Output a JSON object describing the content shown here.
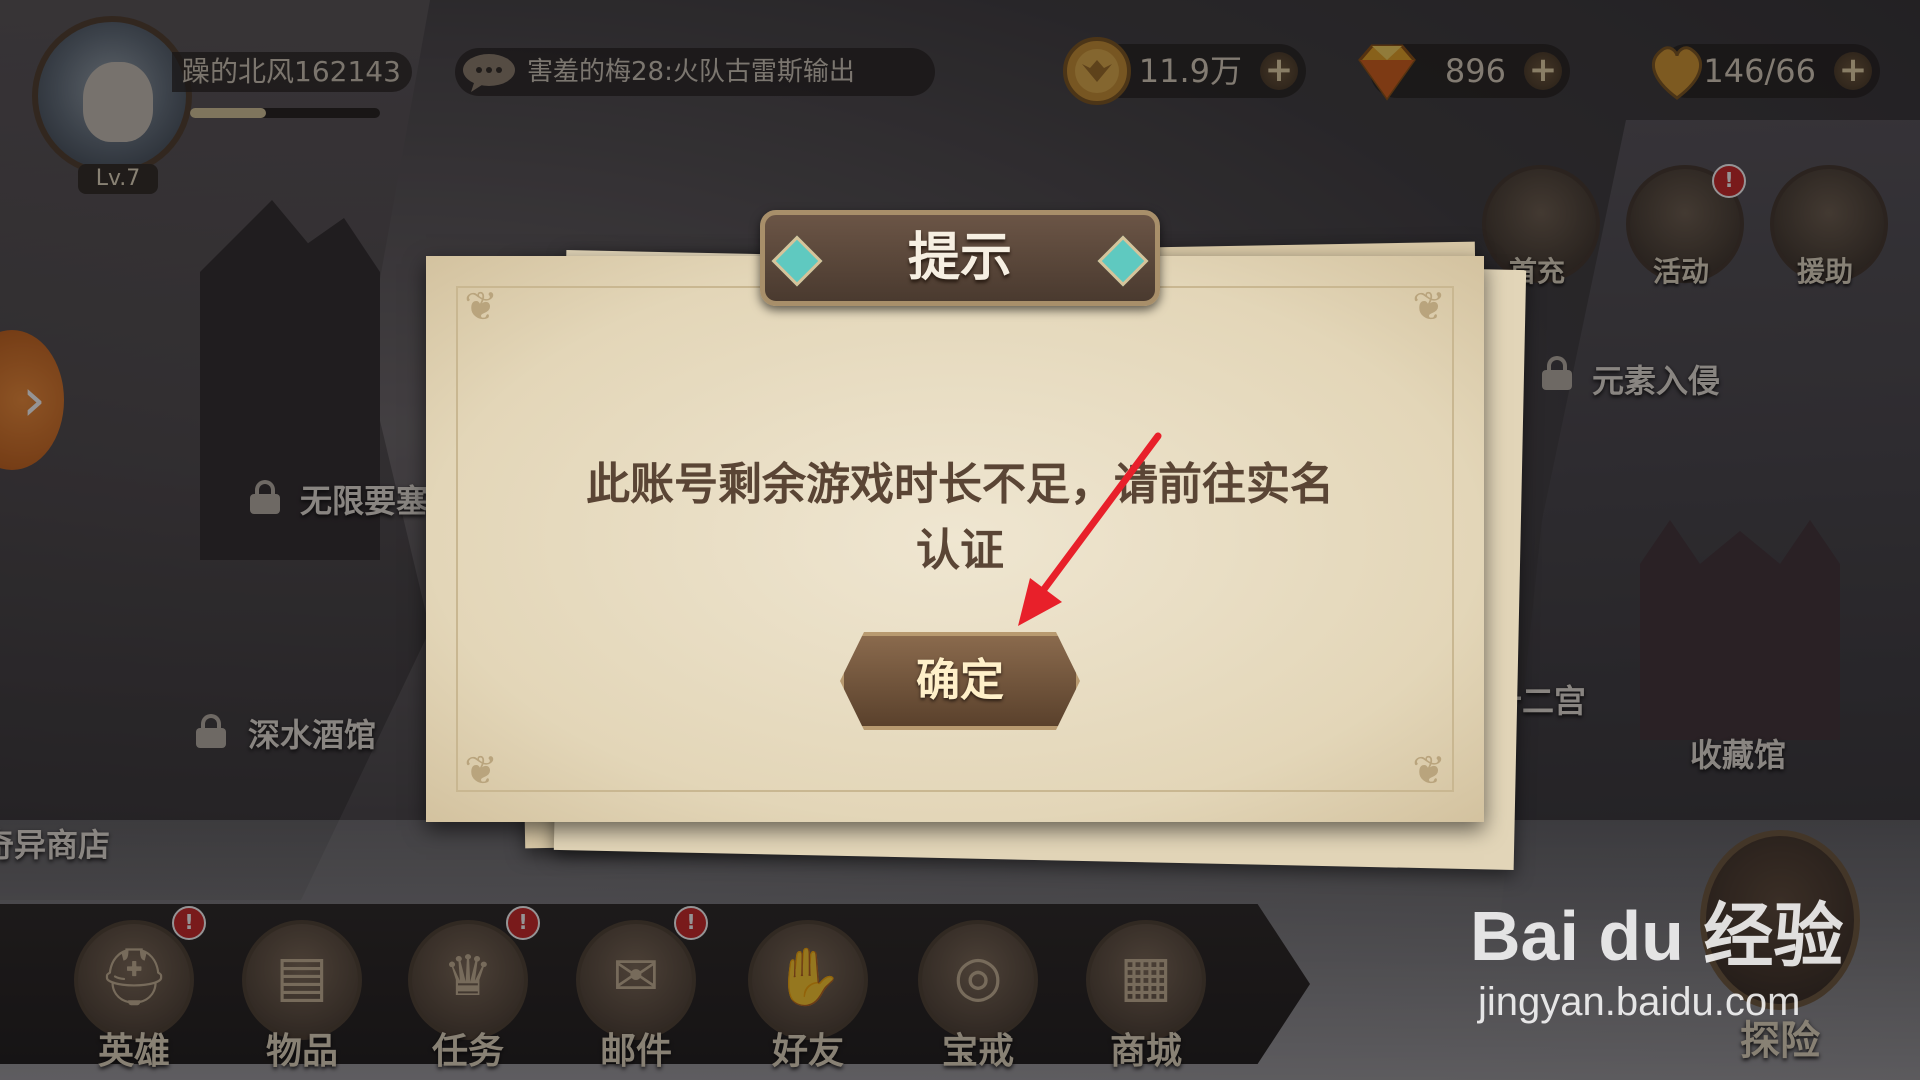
{
  "player": {
    "name": "躁的北风162143",
    "level": "Lv.7",
    "xp_fraction": 0.4
  },
  "chat": {
    "message": "害羞的梅28:火队古雷斯输出"
  },
  "resources": [
    {
      "icon": "gold-coin-icon",
      "value": "11.9万"
    },
    {
      "icon": "diamond-icon",
      "value": "896"
    },
    {
      "icon": "stamina-icon",
      "value": "146/66"
    }
  ],
  "right_buttons": [
    {
      "label": "首充",
      "badge": ""
    },
    {
      "label": "活动",
      "badge": "!"
    },
    {
      "label": "援助",
      "badge": ""
    }
  ],
  "map_labels": {
    "element_invasion": "元素入侵",
    "infinite_fortress": "无限要塞",
    "deep_tavern": "深水酒馆",
    "strange_shop": "奇异商店",
    "twelve_palaces": "十二宫",
    "collection_hall": "收藏馆"
  },
  "bottom_nav": [
    {
      "label": "英雄",
      "glyph": "⛑",
      "badge": "!"
    },
    {
      "label": "物品",
      "glyph": "▤",
      "badge": ""
    },
    {
      "label": "任务",
      "glyph": "♛",
      "badge": "!"
    },
    {
      "label": "邮件",
      "glyph": "✉",
      "badge": "!"
    },
    {
      "label": "好友",
      "glyph": "✋",
      "badge": ""
    },
    {
      "label": "宝戒",
      "glyph": "◎",
      "badge": ""
    },
    {
      "label": "商城",
      "glyph": "▦",
      "badge": ""
    }
  ],
  "explore": {
    "label": "探险"
  },
  "dialog": {
    "title": "提示",
    "message_line1": "此账号剩余游戏时长不足，请前往实名",
    "message_line2": "认证",
    "confirm": "确定"
  },
  "watermark": {
    "logo": "Bai du 经验",
    "url": "jingyan.baidu.com"
  },
  "colors": {
    "annotation_arrow": "#e8202a",
    "side_arrow": "#f08a33"
  }
}
